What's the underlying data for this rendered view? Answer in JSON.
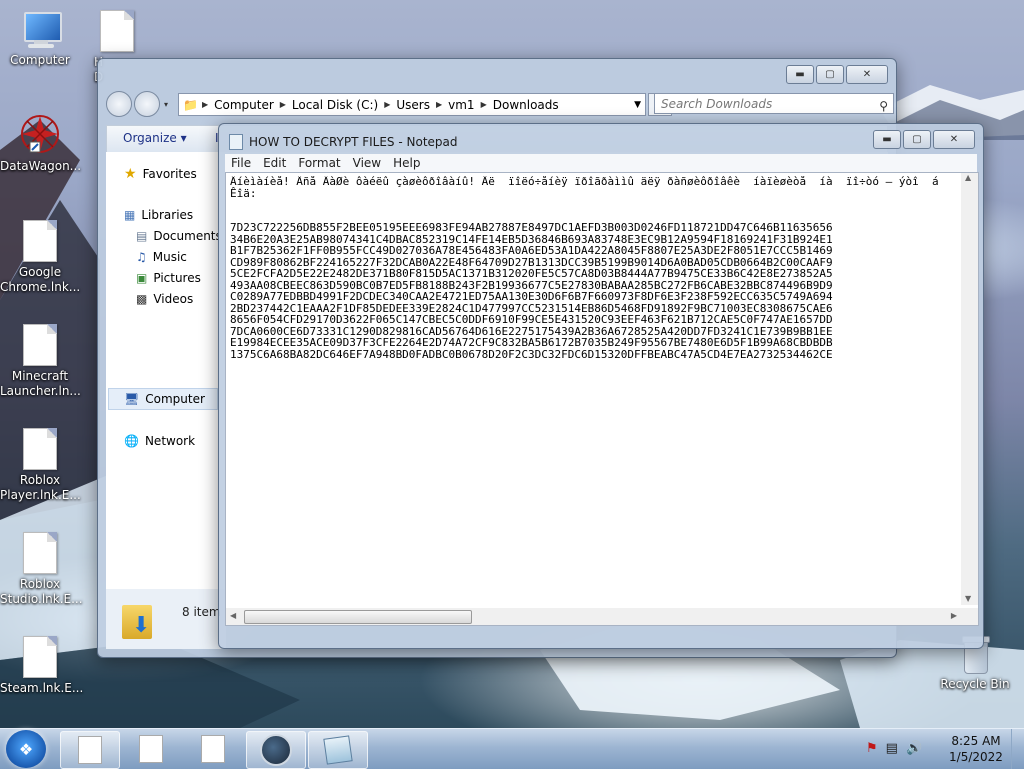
{
  "desktop": {
    "icons": [
      {
        "label": "Computer"
      },
      {
        "label": "H\nD"
      },
      {
        "label": "DataWagon..."
      },
      {
        "label": "Google\nChrome.lnk..."
      },
      {
        "label": "Minecraft\nLauncher.ln..."
      },
      {
        "label": "Roblox\nPlayer.lnk.E..."
      },
      {
        "label": "Roblox\nStudio.lnk.E..."
      },
      {
        "label": "Steam.lnk.E..."
      },
      {
        "label": "Recycle Bin"
      }
    ]
  },
  "explorer": {
    "breadcrumb": [
      "Computer",
      "Local Disk (C:)",
      "Users",
      "vm1",
      "Downloads"
    ],
    "search_placeholder": "Search Downloads",
    "organize_label": "Organize",
    "toolbar_extra": "I",
    "nav": {
      "favorites": "Favorites",
      "libraries": "Libraries",
      "documents": "Documents",
      "music": "Music",
      "pictures": "Pictures",
      "videos": "Videos",
      "computer": "Computer",
      "network": "Network"
    },
    "status_text": "8 item"
  },
  "notepad": {
    "title": "HOW TO DECRYPT FILES - Notepad",
    "menu": [
      "File",
      "Edit",
      "Format",
      "View",
      "Help"
    ],
    "text": "Âíèìàíèå! Âñå ÂàØè ôàéëû çàøèôðîâàíû! Äë  ïîëó÷åíèÿ ïðîãðàììû äëÿ ðàñøèôðîâêè  íàïèøèòå  íà  ïî÷òó – ýòî  á\nÊîä:\n\n\n7D23C722256DB855F2BEE05195EEE6983FE94AB27887E8497DC1AEFD3B003D0246FD118721DD47C646B11635656\n34B6E20A3E25AB98074341C4DBAC852319C14FE14EB5D36846B693A83748E3EC9B12A9594F18169241F31B924E1\nB1F7B25362F1FF0B955FCC49D027036A78E456483FA0A6ED53A1DA422A8045F8807E25A3DE2F8051E7CCC5B1469\nCD989F80862BF224165227F32DCAB0A22E48F64709D27B1313DCC39B5199B9014D6A0BAD05CDB0664B2C00CAAF9\n5CE2FCFA2D5E22E2482DE371B80F815D5AC1371B312020FE5C57CA8D03B8444A77B9475CE33B6C42E8E273852A5\n493AA08CBEEC863D590BC0B7ED5FB8188B243F2B19936677C5E27830BABAA285BC272FB6CABE32BBC874496B9D9\nC0289A77EDBBD4991F2DCDEC340CAA2E4721ED75AA130E30D6F6B7F660973F8DF6E3F238F592ECC635C5749A694\n2BD237442C1EAAA2F1DF85DEDEE339E2824C1D477997CC5231514EB86D5468FD91892F9BC71003EC8308675CAE6\n8656F054CFD29170D3622F065C147CBEC5C0DDF6910F99CE5E431520C93EEF463F621B712CAE5C0F747AE1657DD\n7DCA0600CE6D73331C1290D829816CAD56764D616E2275175439A2B36A6728525A420DD7FD3241C1E739B9BB1EE\nE19984ECEE35ACE09D37F3CFE2264E2D74A72CF9C832BA5B6172B7035B249F95567BE7480E6D5F1B99A68CBDBDB\n1375C6A68BA82DC646EF7A948BD0FADBC0B0678D20F2C3DC32FDC6D15320DFFBEABC47A5CD4E7EA2732534462CE"
  },
  "taskbar": {
    "clock_time": "8:25 AM",
    "clock_date": "1/5/2022"
  },
  "colors": {
    "accent": "#1e3287",
    "taskbar": "#9db5d2"
  }
}
